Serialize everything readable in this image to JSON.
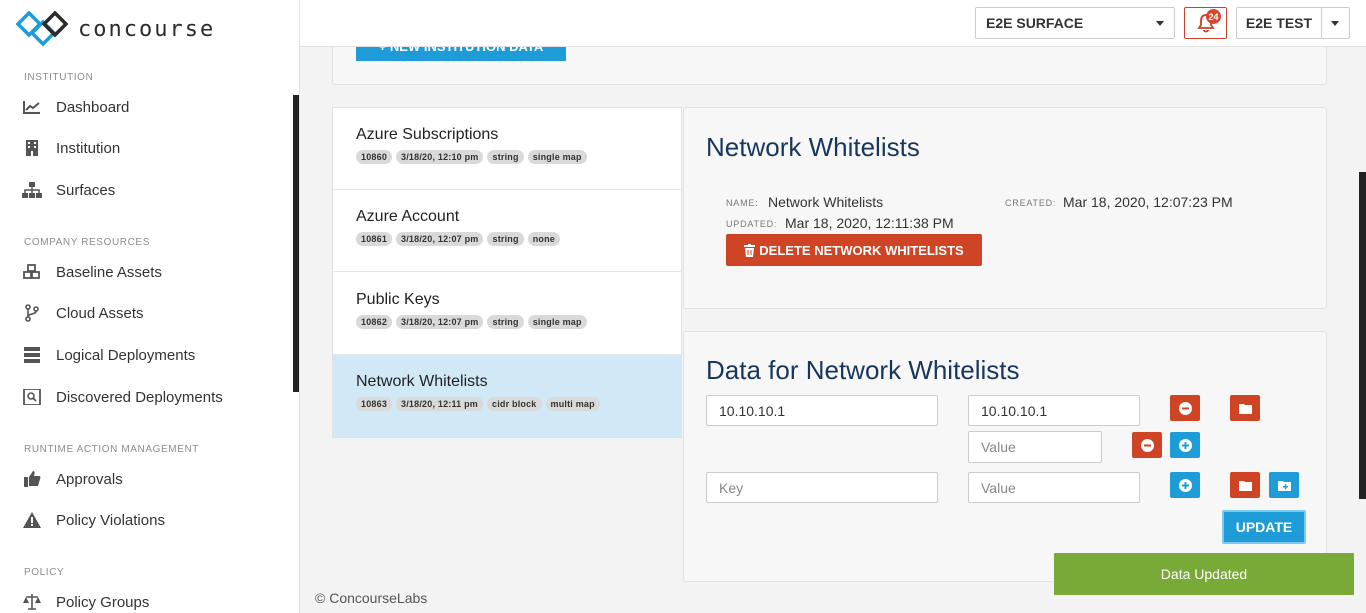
{
  "brand": {
    "name": "concourse"
  },
  "sidebar": {
    "sections": [
      {
        "label": "INSTITUTION"
      },
      {
        "label": "COMPANY RESOURCES"
      },
      {
        "label": "RUNTIME ACTION MANAGEMENT"
      },
      {
        "label": "POLICY"
      }
    ],
    "items": [
      {
        "label": "Dashboard",
        "icon": "chart-line-icon"
      },
      {
        "label": "Institution",
        "icon": "building-icon"
      },
      {
        "label": "Surfaces",
        "icon": "sitemap-icon"
      },
      {
        "label": "Baseline Assets",
        "icon": "cubes-icon"
      },
      {
        "label": "Cloud Assets",
        "icon": "code-branch-icon"
      },
      {
        "label": "Logical Deployments",
        "icon": "server-icon"
      },
      {
        "label": "Discovered Deployments",
        "icon": "search-server-icon"
      },
      {
        "label": "Approvals",
        "icon": "thumbs-up-icon"
      },
      {
        "label": "Policy Violations",
        "icon": "warning-icon"
      },
      {
        "label": "Policy Groups",
        "icon": "balance-scale-icon"
      }
    ]
  },
  "topbar": {
    "surface_select": "E2E SURFACE",
    "notifications_count": "24",
    "user": "E2E TEST"
  },
  "top_panel": {
    "new_button": "+ NEW INSTITUTION DATA"
  },
  "data_list": [
    {
      "title": "Azure Subscriptions",
      "tags": [
        "10860",
        "3/18/20, 12:10 pm",
        "string",
        "single map"
      ]
    },
    {
      "title": "Azure Account",
      "tags": [
        "10861",
        "3/18/20, 12:07 pm",
        "string",
        "none"
      ]
    },
    {
      "title": "Public Keys",
      "tags": [
        "10862",
        "3/18/20, 12:07 pm",
        "string",
        "single map"
      ]
    },
    {
      "title": "Network Whitelists",
      "tags": [
        "10863",
        "3/18/20, 12:11 pm",
        "cidr block",
        "multi map"
      ],
      "active": true
    }
  ],
  "detail": {
    "title": "Network Whitelists",
    "name_label": "NAME:",
    "name": "Network Whitelists",
    "created_label": "CREATED:",
    "created": "Mar 18, 2020, 12:07:23 PM",
    "updated_label": "UPDATED:",
    "updated": "Mar 18, 2020, 12:11:38 PM",
    "delete_button": "DELETE NETWORK WHITELISTS"
  },
  "data_panel": {
    "title": "Data for Network Whitelists",
    "rows": [
      {
        "key": "10.10.10.1",
        "value": "10.10.10.1"
      },
      {
        "value_placeholder": "Value"
      },
      {
        "key_placeholder": "Key",
        "value_placeholder": "Value"
      }
    ],
    "update_button": "UPDATE"
  },
  "footer": {
    "copyright": "© ConcourseLabs"
  },
  "toast": {
    "message": "Data Updated"
  },
  "colors": {
    "primary": "#1e9cd7",
    "danger": "#d04426",
    "heading": "#18375c",
    "success": "#79a937",
    "active_row": "#d1e9f6"
  }
}
